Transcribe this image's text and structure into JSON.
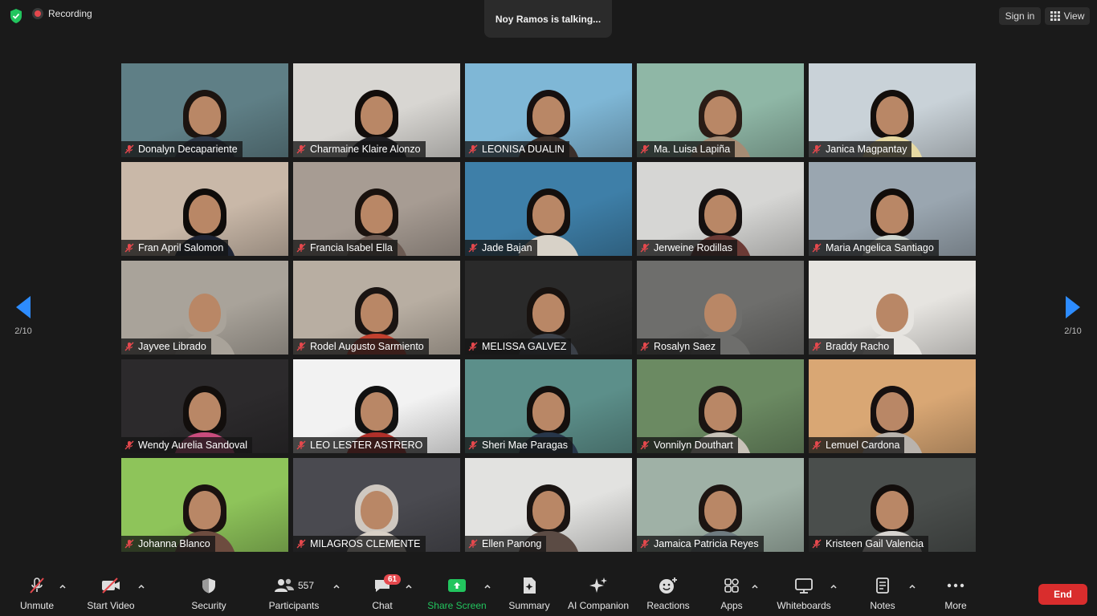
{
  "top": {
    "recording_label": "Recording",
    "talking": "Noy Ramos is talking...",
    "sign_in": "Sign in",
    "view": "View"
  },
  "gallery": {
    "page_left": "2/10",
    "page_right": "2/10",
    "participants": [
      {
        "name": "Donalyn Decapariente",
        "bg": "#5f7f86",
        "hair": "#1c1410",
        "shirt": "#2f3a4a"
      },
      {
        "name": "Charmaine Klaire Alonzo",
        "bg": "#d8d6d2",
        "hair": "#120d0b",
        "shirt": "#1e1e22"
      },
      {
        "name": "LEONISA DUALIN",
        "bg": "#7fb7d6",
        "hair": "#161010",
        "shirt": "#3b2f2a"
      },
      {
        "name": "Ma. Luisa Lapiña",
        "bg": "#8fb7a6",
        "hair": "#2a1c16",
        "shirt": "#a58b74"
      },
      {
        "name": "Janica Magpantay",
        "bg": "#c9d2d8",
        "hair": "#140f0c",
        "shirt": "#e6d9a2"
      },
      {
        "name": "Fran April Salomon",
        "bg": "#c9b8a8",
        "hair": "#0f0c0a",
        "shirt": "#1e2434"
      },
      {
        "name": "Francia Isabel Ella",
        "bg": "#a79c93",
        "hair": "#1a120e",
        "shirt": "#6b5a52"
      },
      {
        "name": "Jade Bajan",
        "bg": "#3e7fa8",
        "hair": "#140f0d",
        "shirt": "#d8d2c8"
      },
      {
        "name": "Jerweine Rodillas",
        "bg": "#d6d6d4",
        "hair": "#151010",
        "shirt": "#6b3a35"
      },
      {
        "name": "Maria Angelica Santiago",
        "bg": "#9aa6b0",
        "hair": "#120d0a",
        "shirt": "#cfd6d0"
      },
      {
        "name": "Jayvee Librado",
        "bg": "#a9a39a",
        "hair": "#a9a39a",
        "shirt": "#a9a39a"
      },
      {
        "name": "Rodel Augusto Sarmiento",
        "bg": "#b8aea2",
        "hair": "#1a1412",
        "shirt": "#c2412f"
      },
      {
        "name": "MELISSA GALVEZ",
        "bg": "#2a2a2a",
        "hair": "#18120f",
        "shirt": "#3b4048"
      },
      {
        "name": "Rosalyn Saez",
        "bg": "#6e6e6c",
        "hair": "#6e6e6c",
        "shirt": "#6e6e6c"
      },
      {
        "name": "Braddy Racho",
        "bg": "#e6e4e0",
        "hair": "#e6e4e0",
        "shirt": "#e6e4e0"
      },
      {
        "name": "Wendy Aurelia Sandoval",
        "bg": "#2c2a2c",
        "hair": "#120e0c",
        "shirt": "#c94c7d"
      },
      {
        "name": "LEO LESTER ASTRERO",
        "bg": "#f2f2f2",
        "hair": "#111",
        "shirt": "#b0302a"
      },
      {
        "name": "Sheri Mae Paragas",
        "bg": "#5c8f8a",
        "hair": "#140f0d",
        "shirt": "#27364a"
      },
      {
        "name": "Vonnilyn Douthart",
        "bg": "#6b8a62",
        "hair": "#1a1412",
        "shirt": "#c8c2b8"
      },
      {
        "name": "Lemuel Cardona",
        "bg": "#d9a774",
        "hair": "#161010",
        "shirt": "#b9b3ad"
      },
      {
        "name": "Johanna Blanco",
        "bg": "#8ec45a",
        "hair": "#1a1210",
        "shirt": "#6d4c3f"
      },
      {
        "name": "MILAGROS CLEMENTE",
        "bg": "#4a4a50",
        "hair": "#cfc8c0",
        "shirt": "#d8d0c6"
      },
      {
        "name": "Ellen Panong",
        "bg": "#e2e2e0",
        "hair": "#1a1412",
        "shirt": "#5b4b44"
      },
      {
        "name": "Jamaica Patricia Reyes",
        "bg": "#9fb1a6",
        "hair": "#1d1512",
        "shirt": "#6f7b80"
      },
      {
        "name": "Kristeen Gail Valencia",
        "bg": "#4a4e4c",
        "hair": "#130e0c",
        "shirt": "#d8d4d0"
      }
    ]
  },
  "toolbar": {
    "unmute": "Unmute",
    "start_video": "Start Video",
    "security": "Security",
    "participants": "Participants",
    "participants_count": "557",
    "chat": "Chat",
    "chat_badge": "61",
    "share_screen": "Share Screen",
    "summary": "Summary",
    "ai_companion": "AI Companion",
    "reactions": "Reactions",
    "apps": "Apps",
    "whiteboards": "Whiteboards",
    "notes": "Notes",
    "more": "More",
    "end": "End"
  },
  "colors": {
    "accent": "#2d8cff",
    "share_green": "#22c55e",
    "end_red": "#d92d2d",
    "mute_red": "#e5484d"
  }
}
